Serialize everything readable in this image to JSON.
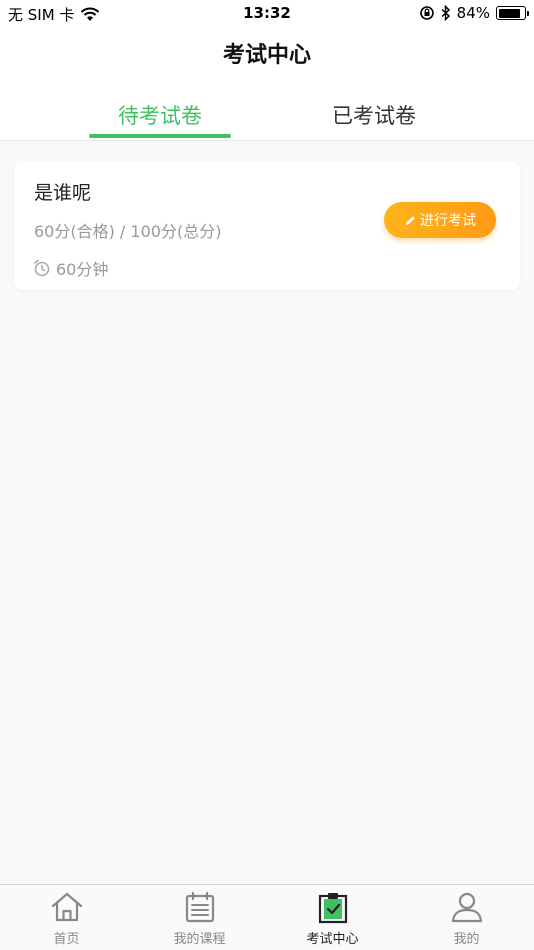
{
  "status_bar": {
    "carrier": "无 SIM 卡",
    "time": "13:32",
    "battery": "84%",
    "battery_level": 0.84
  },
  "header": {
    "title": "考试中心"
  },
  "tabs": [
    {
      "label": "待考试卷",
      "active": true
    },
    {
      "label": "已考试卷",
      "active": false
    }
  ],
  "exams": [
    {
      "title": "是谁呢",
      "score": "60分(合格) / 100分(总分)",
      "duration": "60分钟",
      "action_label": "进行考试"
    }
  ],
  "tabbar": [
    {
      "label": "首页",
      "icon": "home-icon"
    },
    {
      "label": "我的课程",
      "icon": "calendar-icon"
    },
    {
      "label": "考试中心",
      "icon": "clipboard-check-icon",
      "active": true
    },
    {
      "label": "我的",
      "icon": "user-icon"
    }
  ],
  "colors": {
    "accent": "#3fc163",
    "button_gradient_start": "#ffb41a",
    "button_gradient_end": "#ff9a16"
  }
}
